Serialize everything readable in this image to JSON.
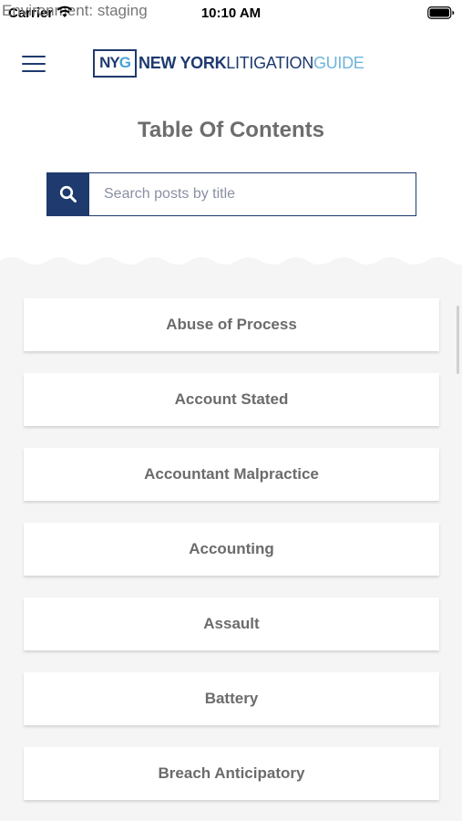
{
  "status_bar": {
    "environment": "Environment: staging",
    "carrier": "Carrier",
    "time": "10:10 AM"
  },
  "header": {
    "logo_mark_ny": "NY",
    "logo_mark_g": "G",
    "logo_new_york": "NEW YORK",
    "logo_litigation": "LITIGATION",
    "logo_guide": "GUIDE"
  },
  "main": {
    "title": "Table Of Contents",
    "search": {
      "placeholder": "Search posts by title",
      "value": ""
    },
    "items": [
      {
        "label": "Abuse of Process"
      },
      {
        "label": "Account Stated"
      },
      {
        "label": "Accountant Malpractice"
      },
      {
        "label": "Accounting"
      },
      {
        "label": "Assault"
      },
      {
        "label": "Battery"
      },
      {
        "label": "Breach Anticipatory"
      }
    ]
  },
  "colors": {
    "brand_navy": "#1e3a6e",
    "brand_light_blue": "#6fb4dc",
    "list_background": "#f5f5f5"
  },
  "icons": {
    "menu": "hamburger-menu-icon",
    "search": "search-icon",
    "wifi": "wifi-icon",
    "battery": "battery-icon"
  }
}
